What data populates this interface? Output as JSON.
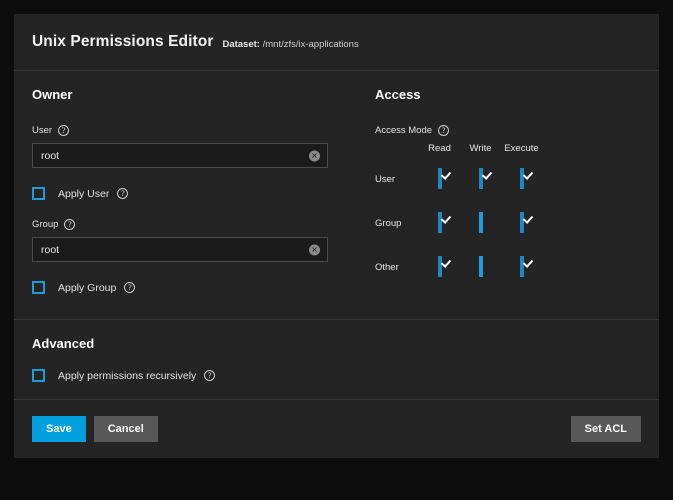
{
  "header": {
    "title": "Unix Permissions Editor",
    "dataset_label": "Dataset:",
    "dataset_value": "/mnt/zfs/ix-applications"
  },
  "owner": {
    "section_title": "Owner",
    "user_label": "User",
    "user_value": "root",
    "apply_user_label": "Apply User",
    "apply_user_checked": false,
    "group_label": "Group",
    "group_value": "root",
    "apply_group_label": "Apply Group",
    "apply_group_checked": false,
    "clear_icon": "clear-icon",
    "help_icon": "?"
  },
  "access": {
    "section_title": "Access",
    "mode_label": "Access Mode",
    "columns": [
      "Read",
      "Write",
      "Execute"
    ],
    "rows": [
      {
        "name": "User",
        "read": true,
        "write": true,
        "execute": true
      },
      {
        "name": "Group",
        "read": true,
        "write": false,
        "execute": true
      },
      {
        "name": "Other",
        "read": true,
        "write": false,
        "execute": true
      }
    ]
  },
  "advanced": {
    "section_title": "Advanced",
    "recursive_label": "Apply permissions recursively",
    "recursive_checked": false
  },
  "footer": {
    "save_label": "Save",
    "cancel_label": "Cancel",
    "set_acl_label": "Set ACL"
  },
  "colors": {
    "accent": "#00a0df",
    "checkbox_checked": "#1f87c4",
    "checkbox_border": "#1f9bd7",
    "card_bg": "#242424",
    "page_bg": "#0d0d0d",
    "button_gray": "#585858"
  }
}
